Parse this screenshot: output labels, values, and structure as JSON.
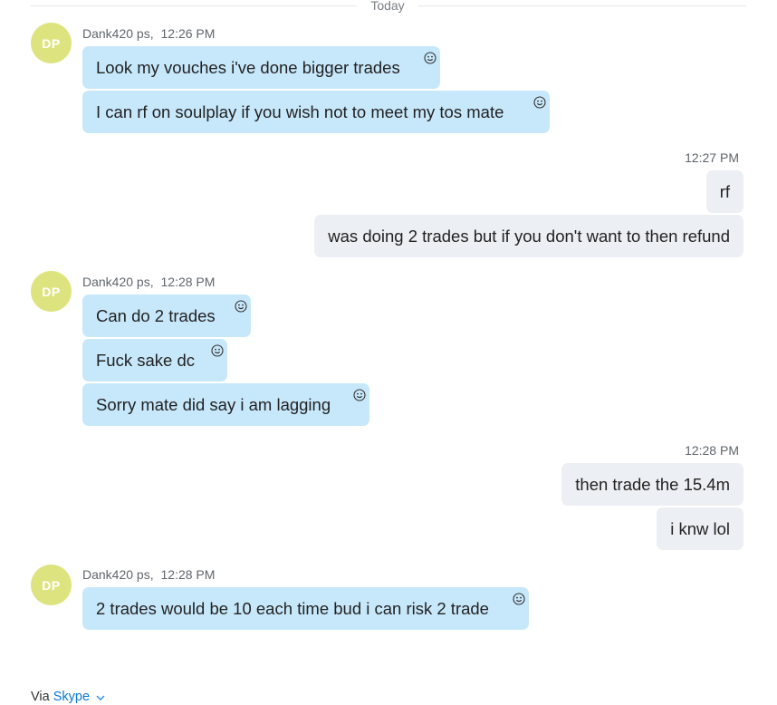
{
  "divider": {
    "label": "Today"
  },
  "groups": [
    {
      "avatar": "DP",
      "sender": "Dank420 ps,",
      "time": "12:26 PM",
      "messages": [
        "Look my vouches i've done bigger trades",
        "I can rf on soulplay if you wish not to meet my tos mate"
      ]
    },
    {
      "time": "12:27 PM",
      "messages": [
        "rf",
        "was doing 2 trades but if you don't want to then refund"
      ]
    },
    {
      "avatar": "DP",
      "sender": "Dank420 ps,",
      "time": "12:28 PM",
      "messages": [
        "Can do 2 trades",
        "Fuck sake dc",
        "Sorry mate did say i am lagging"
      ]
    },
    {
      "time": "12:28 PM",
      "messages": [
        "then trade the 15.4m",
        "i knw lol"
      ]
    },
    {
      "avatar": "DP",
      "sender": "Dank420 ps,",
      "time": "12:28 PM",
      "messages": [
        "2 trades would be 10 each time bud i can risk 2 trade"
      ]
    }
  ],
  "footer": {
    "via": "Via",
    "link": "Skype"
  },
  "icons": {
    "reaction": "smiley-icon",
    "chevron": "chevron-down-icon"
  }
}
